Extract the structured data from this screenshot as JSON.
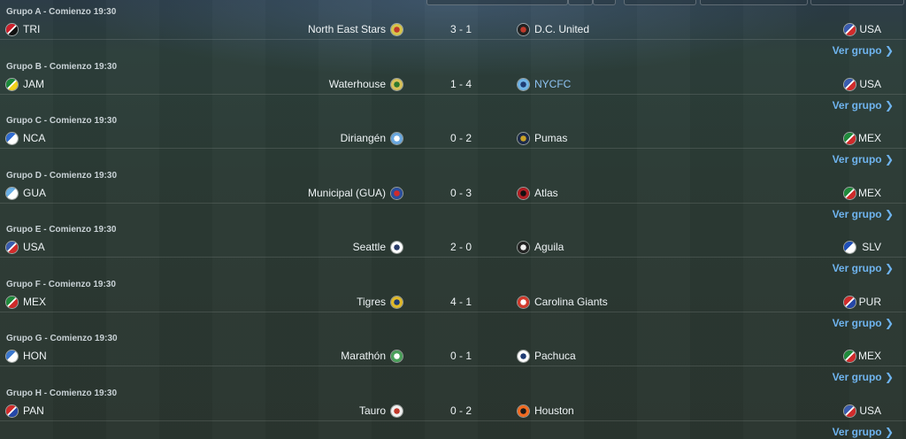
{
  "groups": [
    {
      "title": "Grupo A - Comienzo 19:30",
      "home_country": "TRI",
      "home_team": "North East Stars",
      "score": "3 - 1",
      "away_team": "D.C. United",
      "away_country": "USA",
      "link": "Ver grupo ❯",
      "home_flag": [
        "#cc1f2b",
        "#111111"
      ],
      "home_crest": [
        "#d8c44a",
        "#c0392b"
      ],
      "away_crest": [
        "#222222",
        "#c0392b"
      ],
      "away_flag": [
        "#3a5cb0",
        "#d12b2b"
      ]
    },
    {
      "title": "Grupo B - Comienzo 19:30",
      "home_country": "JAM",
      "home_team": "Waterhouse",
      "score": "1 - 4",
      "away_team": "NYCFC",
      "away_country": "USA",
      "link": "Ver grupo ❯",
      "home_flag": [
        "#1b8a3a",
        "#f2d21c"
      ],
      "home_crest": [
        "#d9c25a",
        "#2e7a2e"
      ],
      "away_crest": [
        "#6fb4e8",
        "#1f3b73"
      ],
      "away_flag": [
        "#3a5cb0",
        "#d12b2b"
      ]
    },
    {
      "title": "Grupo C - Comienzo 19:30",
      "home_country": "NCA",
      "home_team": "Diriangén",
      "score": "0 - 2",
      "away_team": "Pumas",
      "away_country": "MEX",
      "link": "Ver grupo ❯",
      "home_flag": [
        "#2f6bd1",
        "#ffffff"
      ],
      "home_crest": [
        "#6aa8e0",
        "#ffffff"
      ],
      "away_crest": [
        "#1c2a4a",
        "#c9a227"
      ],
      "away_flag": [
        "#1f8a3b",
        "#cf2a2a"
      ]
    },
    {
      "title": "Grupo D - Comienzo 19:30",
      "home_country": "GUA",
      "home_team": "Municipal (GUA)",
      "score": "0 - 3",
      "away_team": "Atlas",
      "away_country": "MEX",
      "link": "Ver grupo ❯",
      "home_flag": [
        "#6ab0e6",
        "#ffffff"
      ],
      "home_crest": [
        "#2b4f9e",
        "#d12b2b"
      ],
      "away_crest": [
        "#b01f24",
        "#111111"
      ],
      "away_flag": [
        "#1f8a3b",
        "#cf2a2a"
      ]
    },
    {
      "title": "Grupo E - Comienzo 19:30",
      "home_country": "USA",
      "home_team": "Seattle",
      "score": "2 - 0",
      "away_team": "Aguila",
      "away_country": "SLV",
      "link": "Ver grupo ❯",
      "home_flag": [
        "#3a5cb0",
        "#d12b2b"
      ],
      "home_crest": [
        "#ffffff",
        "#2a3d6b"
      ],
      "away_crest": [
        "#222222",
        "#f0f0f0"
      ],
      "away_flag": [
        "#1f4fb8",
        "#ffffff"
      ]
    },
    {
      "title": "Grupo F - Comienzo 19:30",
      "home_country": "MEX",
      "home_team": "Tigres",
      "score": "4 - 1",
      "away_team": "Carolina Giants",
      "away_country": "PUR",
      "link": "Ver grupo ❯",
      "home_flag": [
        "#1f8a3b",
        "#cf2a2a"
      ],
      "home_crest": [
        "#e0b92a",
        "#1f3b73"
      ],
      "away_crest": [
        "#d33a2c",
        "#ffffff"
      ],
      "away_flag": [
        "#d12b2b",
        "#2547a8"
      ]
    },
    {
      "title": "Grupo G - Comienzo 19:30",
      "home_country": "HON",
      "home_team": "Marathón",
      "score": "0 - 1",
      "away_team": "Pachuca",
      "away_country": "MEX",
      "link": "Ver grupo ❯",
      "home_flag": [
        "#3a77cf",
        "#ffffff"
      ],
      "home_crest": [
        "#4aa05a",
        "#ffffff"
      ],
      "away_crest": [
        "#ffffff",
        "#1f3b73"
      ],
      "away_flag": [
        "#1f8a3b",
        "#cf2a2a"
      ]
    },
    {
      "title": "Grupo H - Comienzo 19:30",
      "home_country": "PAN",
      "home_team": "Tauro",
      "score": "0 - 2",
      "away_team": "Houston",
      "away_country": "USA",
      "link": "Ver grupo ❯",
      "home_flag": [
        "#d12b2b",
        "#2547a8"
      ],
      "home_crest": [
        "#f0f0f0",
        "#c0392b"
      ],
      "away_crest": [
        "#f26b21",
        "#1a1a1a"
      ],
      "away_flag": [
        "#3a5cb0",
        "#d12b2b"
      ]
    }
  ]
}
